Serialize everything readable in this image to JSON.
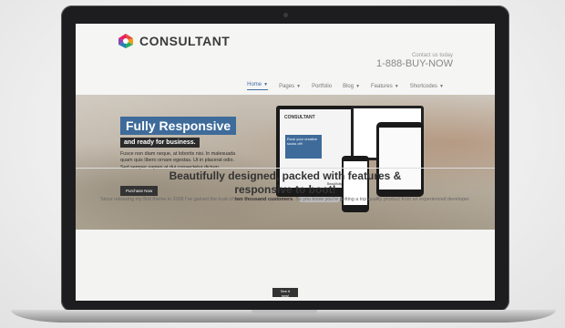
{
  "site": {
    "logo_text": "CONSULTANT",
    "contact_label": "Contact us today",
    "contact_phone": "1-888-BUY-NOW"
  },
  "nav": {
    "items": [
      {
        "label": "Home",
        "active": true,
        "dropdown": true
      },
      {
        "label": "Pages",
        "active": false,
        "dropdown": true
      },
      {
        "label": "Portfolio",
        "active": false,
        "dropdown": false
      },
      {
        "label": "Blog",
        "active": false,
        "dropdown": true
      },
      {
        "label": "Features",
        "active": false,
        "dropdown": true
      },
      {
        "label": "Shortcodes",
        "active": false,
        "dropdown": true
      }
    ]
  },
  "hero": {
    "title": "Fully Responsive",
    "subtitle": "and ready for business.",
    "body": "Fusce non diam neque, at lobortis nisi. In malesuada quam quis libero ornare egestas. Ut in placerat odio. Sed semper sapien at dui consectetur dictum.",
    "button": "Purchase Now"
  },
  "devices": {
    "logo_text": "CONSULTANT",
    "mini_hero_text": "Rock your creative socks off!",
    "mini_caption": "Beautifully designed"
  },
  "features": {
    "title_line1": "Beautifully designed, packed with features &",
    "title_line2": "responsive to boot!",
    "text_before": "Since releasing my first theme in 2008 I've gained the trust of ",
    "text_bold": "two thousand customers",
    "text_after": ". So you know you're getting a top quality product from an experienced developer.",
    "button": "See it now!"
  },
  "colors": {
    "accent": "#3e6b9a",
    "dark": "#2b2b2b"
  }
}
